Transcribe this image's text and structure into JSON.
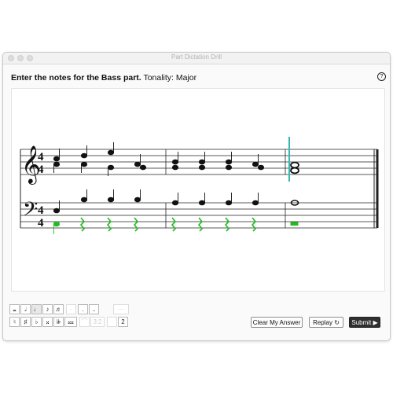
{
  "window": {
    "title": "Part Dictation Drill"
  },
  "prompt": {
    "instruction": "Enter the notes for the Bass part.",
    "tonality": "Tonality: Major"
  },
  "help_icon": "?",
  "score": {
    "time_signature": [
      "4",
      "4"
    ],
    "treble_notes": "mezzo-soprano/alto chords in 3 measures",
    "playback_cursor_color": "#36b7b0",
    "entered_color": "#22bb22"
  },
  "toolbar": {
    "row1": [
      "𝅜",
      "𝅗𝅥",
      "♩",
      "♪",
      "♬",
      "·",
      ".",
      "..",
      "⋯"
    ],
    "row2": [
      "♮",
      "♯",
      "♭",
      "𝄪",
      "𝄫",
      "𝄪𝄪",
      "⌒",
      "3:2",
      "",
      "2"
    ]
  },
  "buttons": {
    "clear": "Clear My Answer",
    "replay": "Replay ↻",
    "submit": "Submit ▶"
  }
}
